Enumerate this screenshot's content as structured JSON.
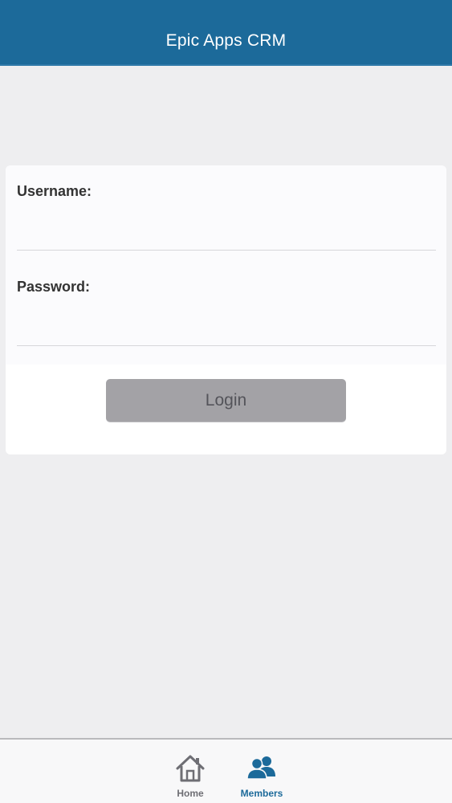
{
  "header": {
    "title": "Epic Apps CRM"
  },
  "login_form": {
    "username_label": "Username:",
    "username_value": "",
    "password_label": "Password:",
    "password_value": "",
    "login_button_label": "Login"
  },
  "tab_bar": {
    "tabs": [
      {
        "label": "Home",
        "icon": "home-icon",
        "active": false
      },
      {
        "label": "Members",
        "icon": "members-icon",
        "active": true
      }
    ]
  },
  "colors": {
    "header": "#1c6a9a",
    "active_tab": "#1c6a9a",
    "inactive_tab": "#6e6e74",
    "login_button": "#a3a2a6",
    "background": "#eeeef0"
  }
}
